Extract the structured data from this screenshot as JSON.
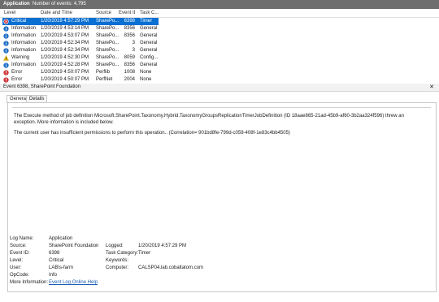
{
  "title_bar": {
    "app": "Application",
    "count_label": "Number of events: 4,795"
  },
  "table": {
    "columns": [
      "Level",
      "Date and Time",
      "Source",
      "Event ID",
      "Task C..."
    ],
    "rows": [
      {
        "level": "Critical",
        "icon": "critical-icon",
        "date": "1/20/2019 4:57:29 PM",
        "source": "SharePo...",
        "id": "6398",
        "task": "Timer",
        "selected": true
      },
      {
        "level": "Information",
        "icon": "info-icon",
        "date": "1/20/2019 4:53:14 PM",
        "source": "SharePo...",
        "id": "8356",
        "task": "General"
      },
      {
        "level": "Information",
        "icon": "info-icon",
        "date": "1/20/2019 4:53:07 PM",
        "source": "SharePo...",
        "id": "8356",
        "task": "General"
      },
      {
        "level": "Information",
        "icon": "info-icon",
        "date": "1/20/2019 4:52:34 PM",
        "source": "SharePo...",
        "id": "3",
        "task": "General"
      },
      {
        "level": "Information",
        "icon": "info-icon",
        "date": "1/20/2019 4:52:34 PM",
        "source": "SharePo...",
        "id": "3",
        "task": "General"
      },
      {
        "level": "Warning",
        "icon": "warning-icon",
        "date": "1/20/2019 4:52:30 PM",
        "source": "SharePo...",
        "id": "8059",
        "task": "Config..."
      },
      {
        "level": "Information",
        "icon": "info-icon",
        "date": "1/20/2019 4:52:28 PM",
        "source": "SharePo...",
        "id": "8356",
        "task": "General"
      },
      {
        "level": "Error",
        "icon": "error-icon",
        "date": "1/20/2019 4:50:07 PM",
        "source": "Perflib",
        "id": "1008",
        "task": "None"
      },
      {
        "level": "Error",
        "icon": "error-icon",
        "date": "1/20/2019 4:50:07 PM",
        "source": "PerfNet",
        "id": "2004",
        "task": "None"
      }
    ]
  },
  "detail": {
    "header": "Event 6398, SharePoint Foundation",
    "close": "✕",
    "tabs": [
      "General",
      "Details"
    ],
    "message1": "The Execute method of job definition Microsoft.SharePoint.Taxonomy.Hybrid.TaxonomyGroupsReplicationTimerJobDefinition (ID 18aae865-21ad-45b9-af60-3b2aa324f596) threw an exception. More information is included below.",
    "message2": "The current user has insufficient permissions to perform this operation.. (Correlation= 901bd8fe-799d-c059-408f-1e83c4bb4505)",
    "props": {
      "log_name_label": "Log Name:",
      "log_name": "Application",
      "source_label": "Source:",
      "source": "SharePoint Foundation",
      "logged_label": "Logged:",
      "logged": "1/20/2019 4:57:29 PM",
      "event_id_label": "Event ID:",
      "event_id": "6398",
      "task_label": "Task Category:",
      "task": "Timer",
      "level_label": "Level:",
      "level": "Critical",
      "keywords_label": "Keywords:",
      "keywords": "",
      "user_label": "User:",
      "user": "LAB\\s-farm",
      "computer_label": "Computer:",
      "computer": "CALSP04.lab.cobaltatom.com",
      "opcode_label": "OpCode:",
      "opcode": "Info",
      "more_label": "More Information:",
      "more_link": "Event Log Online Help"
    }
  }
}
